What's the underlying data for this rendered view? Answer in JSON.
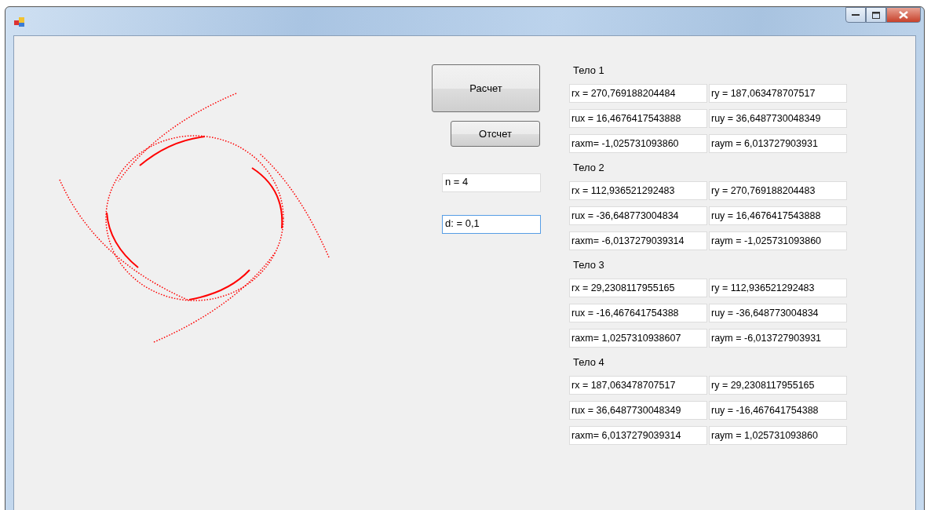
{
  "window": {
    "controls": [
      {
        "kind": "minimize"
      },
      {
        "kind": "maximize"
      },
      {
        "kind": "close"
      }
    ]
  },
  "buttons": [
    {
      "label": "Расчет",
      "kind": "large"
    },
    {
      "label": "Отсчет",
      "kind": "small"
    }
  ],
  "fields": [
    {
      "value": "n = 4",
      "focused": false
    },
    {
      "value": "d: = 0,1",
      "focused": true
    }
  ],
  "bodies": [
    {
      "title": "Тело 1",
      "values": [
        "rx = 270,769188204484",
        "ry = 187,063478707517",
        "rux = 16,4676417543888",
        "ruy = 36,6487730048349",
        "raxm= -1,025731093860",
        "raym = 6,013727903931"
      ]
    },
    {
      "title": "Тело 2",
      "values": [
        "rx = 112,936521292483",
        "ry = 270,769188204483",
        "rux = -36,648773004834",
        "ruy = 16,4676417543888",
        "raxm= -6,0137279039314",
        "raym = -1,025731093860"
      ]
    },
    {
      "title": "Тело 3",
      "values": [
        "rx = 29,2308117955165",
        "ry = 112,936521292483",
        "rux = -16,467641754388",
        "ruy = -36,648773004834",
        "raxm= 1,0257310938607",
        "raym = -6,013727903931"
      ]
    },
    {
      "title": "Тело 4",
      "values": [
        "rx = 187,063478707517",
        "ry = 29,2308117955165",
        "rux = 36,6487730048349",
        "ruy = -16,467641754388",
        "raxm= 6,0137279039314",
        "raym = 1,025731093860"
      ]
    }
  ]
}
